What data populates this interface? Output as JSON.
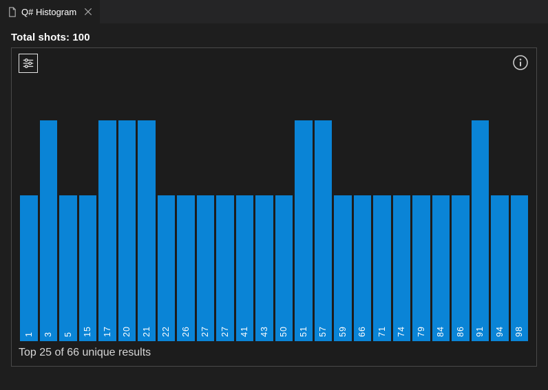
{
  "tab": {
    "label": "Q# Histogram"
  },
  "header": {
    "total_shots_label": "Total shots: 100"
  },
  "footer": {
    "summary": "Top 25 of 66 unique results"
  },
  "chart_data": {
    "type": "bar",
    "title": "Q# Histogram",
    "xlabel": "",
    "ylabel": "",
    "ylim": [
      0,
      2
    ],
    "categories": [
      "1",
      "3",
      "5",
      "15",
      "17",
      "20",
      "21",
      "22",
      "26",
      "27",
      "27",
      "41",
      "43",
      "50",
      "51",
      "57",
      "59",
      "66",
      "71",
      "74",
      "79",
      "84",
      "86",
      "91",
      "94",
      "98"
    ],
    "values": [
      1,
      2,
      1,
      1,
      2,
      2,
      2,
      1,
      1,
      1,
      1,
      1,
      1,
      1,
      2,
      2,
      1,
      1,
      1,
      1,
      1,
      1,
      1,
      2,
      1,
      1
    ]
  }
}
